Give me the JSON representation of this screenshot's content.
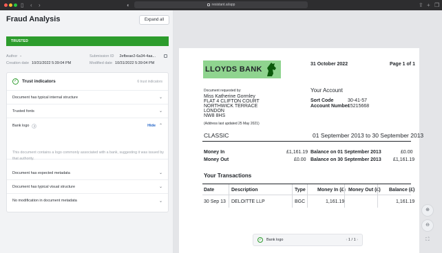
{
  "browser": {
    "url": "resistant.ai/app"
  },
  "left_panel": {
    "title": "Fraud Analysis",
    "expand_all_label": "Expand all",
    "status_banner": "TRUSTED",
    "meta": {
      "author_label": "Author",
      "author_value": "-",
      "submission_label": "Submission ID",
      "submission_value": "2efbeae2-6a34-4aa...",
      "creation_label": "Creation date",
      "creation_value": "10/31/2022 5:39:04 PM",
      "modified_label": "Modified date",
      "modified_value": "10/31/2022 5:39:04 PM"
    },
    "trust_card": {
      "title": "Trust indicators",
      "count": "6 trust indicators",
      "items": [
        {
          "label": "Document has typical internal structure"
        },
        {
          "label": "Trusted fonts"
        },
        {
          "label": "Bank logo",
          "badge": "2",
          "action": "Hide",
          "description": "This document contains a logo commonly associated with a bank, suggesting it was issued by that authority."
        },
        {
          "label": "Document has expected metadata"
        },
        {
          "label": "Document has typical visual structure"
        },
        {
          "label": "No modification in document metadata"
        }
      ]
    }
  },
  "document": {
    "bank_name": "LLOYDS BANK",
    "date": "31 October 2022",
    "page": "Page 1 of 1",
    "requested_by_label": "Document requested by:",
    "address_lines": [
      "Miss Katherine Gormley",
      "FLAT 4 CLIFTON COURT",
      "NORTHWICK TERRACE",
      "LONDON",
      "NW8  8HS"
    ],
    "address_updated": "(Address last updated 25 May 2021)",
    "your_account_title": "Your Account",
    "sort_code_label": "Sort Code",
    "sort_code_value": "30-41-57",
    "account_number_label": "Account Number",
    "account_number_value": "15215668",
    "account_type": "CLASSIC",
    "period": "01 September 2013 to 30 September 2013",
    "money_in_label": "Money In",
    "money_in_value": "£1,161.19",
    "money_out_label": "Money Out",
    "money_out_value": "£0.00",
    "balance_start_label": "Balance on 01 September 2013",
    "balance_start_value": "£0.00",
    "balance_end_label": "Balance on 30 September 2013",
    "balance_end_value": "£1,161.19",
    "transactions_title": "Your Transactions",
    "table_headers": [
      "Date",
      "Description",
      "Type",
      "Money In (£)",
      "Money Out (£)",
      "Balance (£)"
    ],
    "table_rows": [
      [
        "30 Sep 13",
        "DELOITTE LLP",
        "BGC",
        "1,161.19",
        "",
        "1,161.19"
      ]
    ]
  },
  "viewer_pill": {
    "label": "Bank logo",
    "pager": "1 / 1"
  },
  "colors": {
    "trusted_green": "#2d9c2d",
    "logo_highlight": "#8fd48f",
    "link_blue": "#2566c8"
  },
  "icons": [
    "sidebar-icon",
    "back-icon",
    "forward-icon",
    "shield-icon",
    "share-icon",
    "new-tab-icon",
    "tabs-icon",
    "copy-icon",
    "check-icon",
    "chevron-down-icon",
    "chevron-up-icon",
    "zoom-in-icon",
    "zoom-out-icon",
    "fullscreen-icon"
  ]
}
